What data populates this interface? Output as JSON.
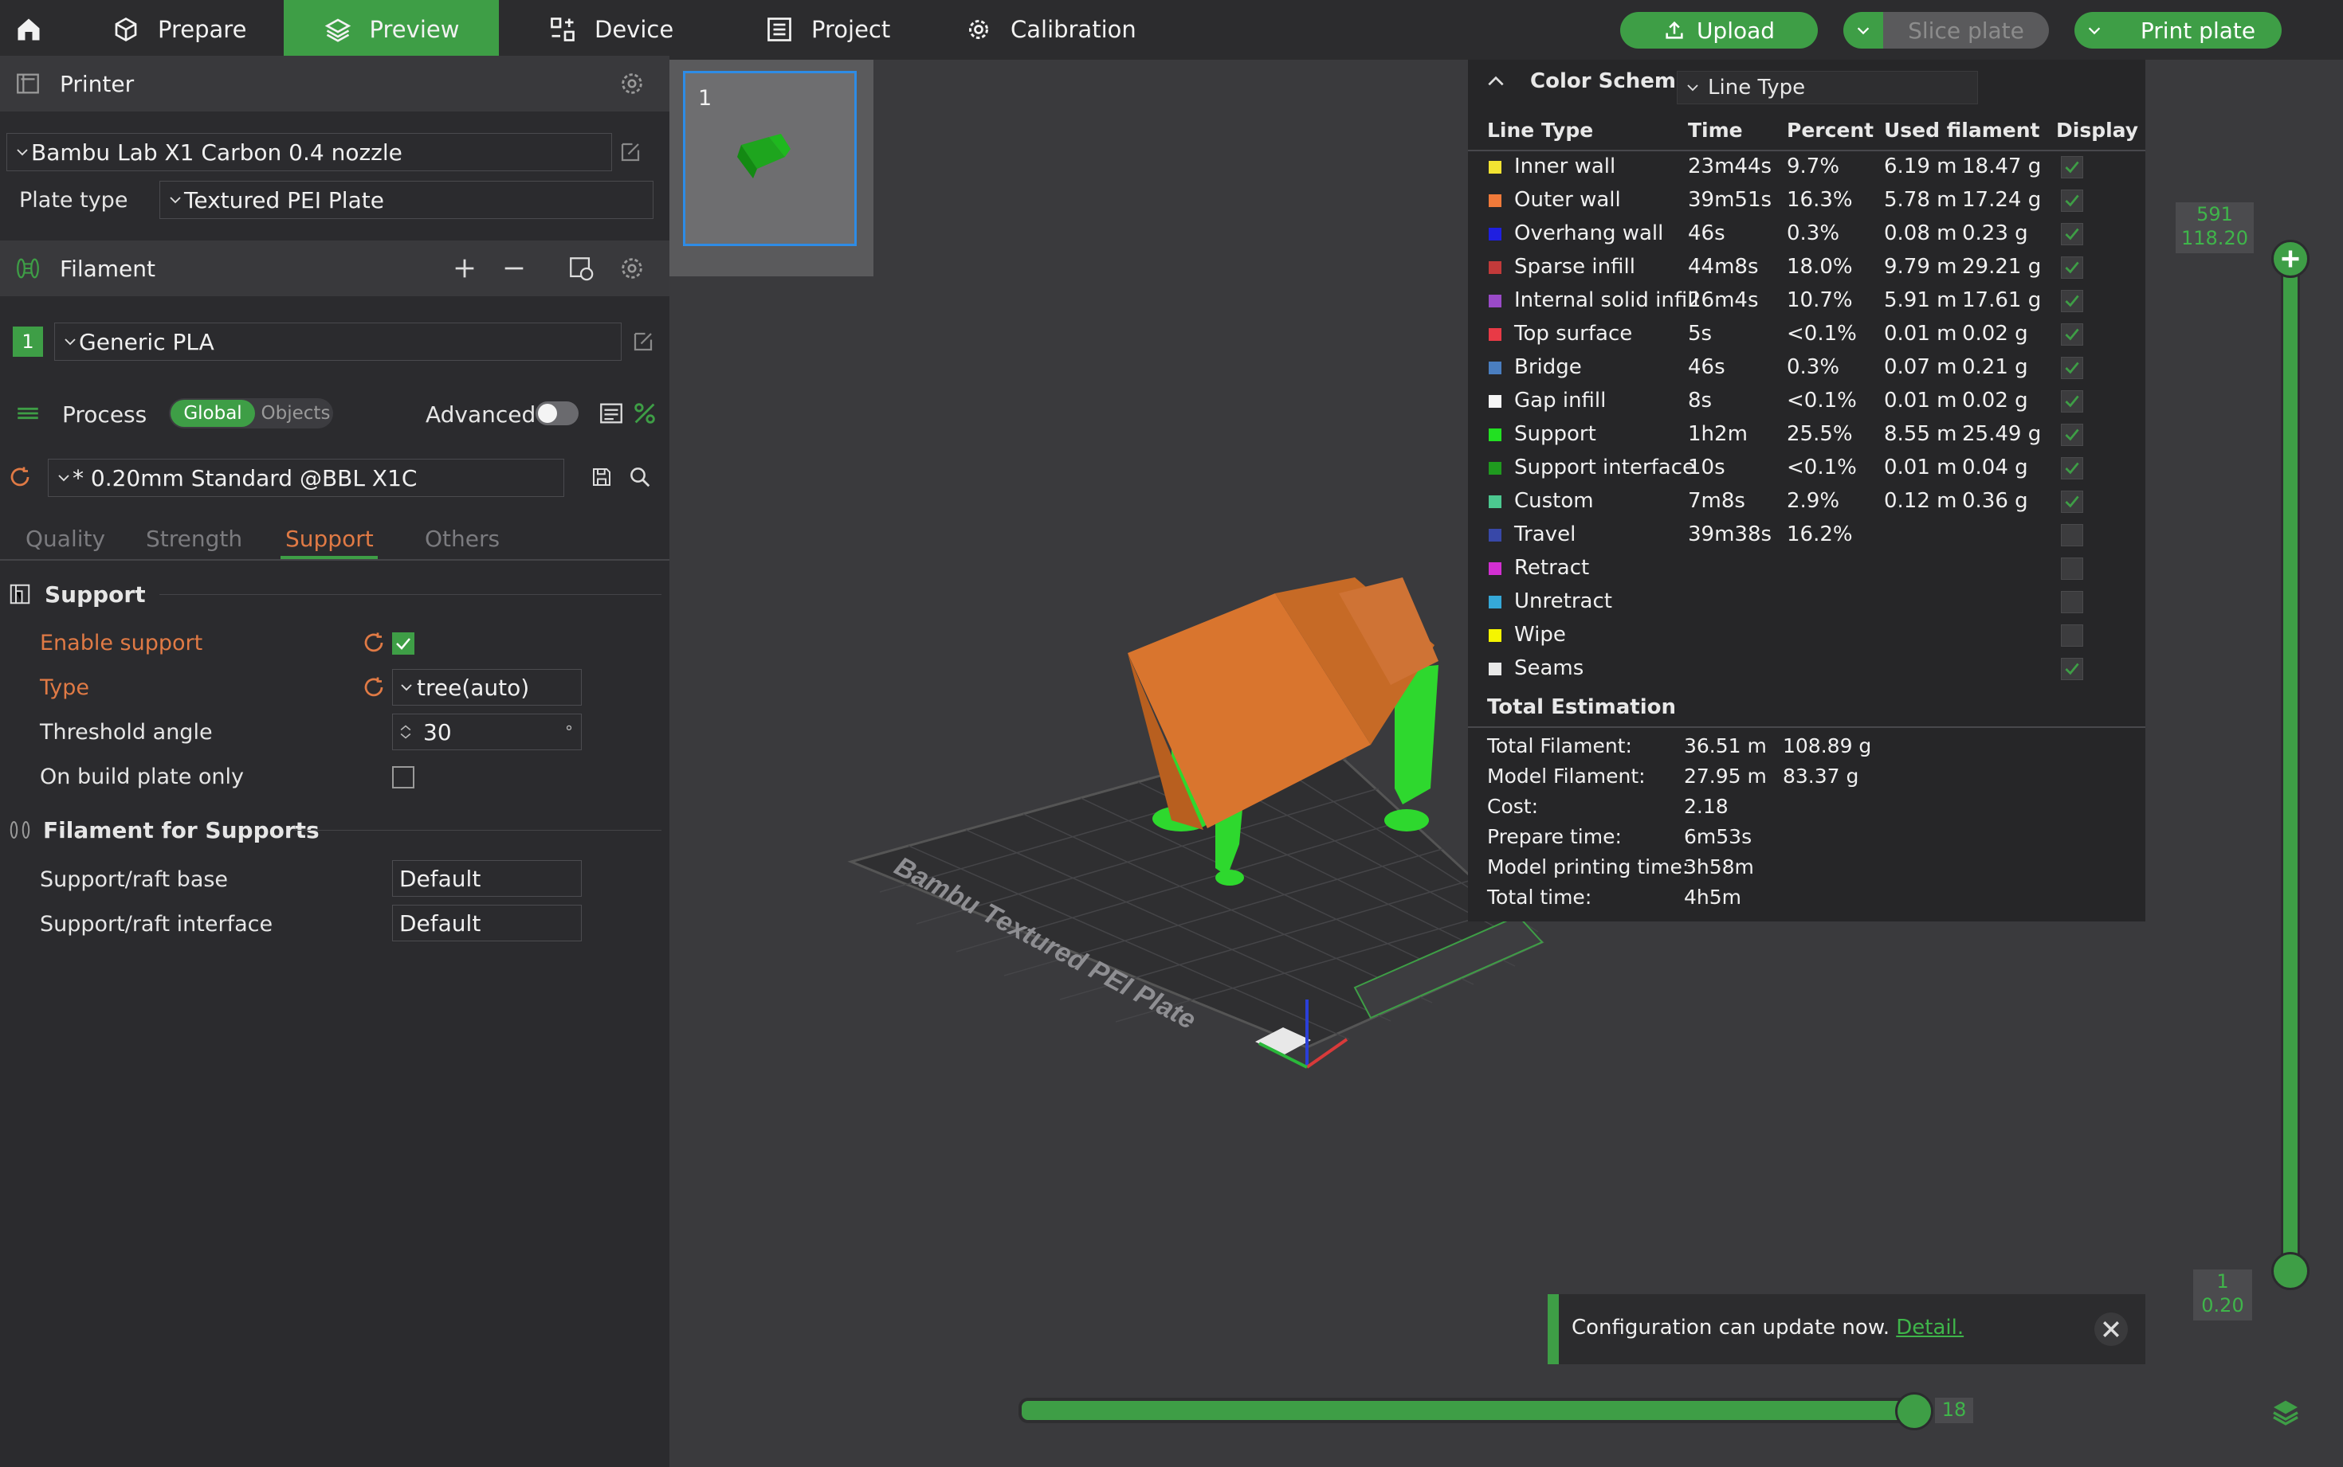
{
  "topbar": {
    "tabs": [
      "Prepare",
      "Preview",
      "Device",
      "Project",
      "Calibration"
    ],
    "upload": "Upload",
    "slice": "Slice plate",
    "print": "Print plate"
  },
  "printer": {
    "title": "Printer",
    "model": "Bambu Lab X1 Carbon 0.4 nozzle",
    "plate_type_label": "Plate type",
    "plate_type": "Textured PEI Plate"
  },
  "filament": {
    "title": "Filament",
    "slot": "1",
    "name": "Generic PLA"
  },
  "process": {
    "title": "Process",
    "global": "Global",
    "objects": "Objects",
    "advanced": "Advanced",
    "profile": "* 0.20mm Standard @BBL X1C",
    "tabs": [
      "Quality",
      "Strength",
      "Support",
      "Others"
    ]
  },
  "support": {
    "title": "Support",
    "enable_label": "Enable support",
    "type_label": "Type",
    "type_value": "tree(auto)",
    "threshold_label": "Threshold angle",
    "threshold_value": "30",
    "threshold_unit": "°",
    "build_plate_label": "On build plate only",
    "filament_title": "Filament for Supports",
    "base_label": "Support/raft base",
    "base_value": "Default",
    "interface_label": "Support/raft interface",
    "interface_value": "Default"
  },
  "thumbnail": {
    "number": "1"
  },
  "legend": {
    "title": "Color Scheme",
    "scheme": "Line Type",
    "headers": [
      "Line Type",
      "Time",
      "Percent",
      "Used filament",
      "Display"
    ],
    "rows": [
      {
        "name": "Inner wall",
        "time": "23m44s",
        "percent": "9.7%",
        "len": "6.19 m",
        "weight": "18.47 g",
        "color": "#f2e332",
        "shown": true
      },
      {
        "name": "Outer wall",
        "time": "39m51s",
        "percent": "16.3%",
        "len": "5.78 m",
        "weight": "17.24 g",
        "color": "#f07a3a",
        "shown": true
      },
      {
        "name": "Overhang wall",
        "time": "46s",
        "percent": "0.3%",
        "len": "0.08 m",
        "weight": "0.23 g",
        "color": "#1f1fe0",
        "shown": true
      },
      {
        "name": "Sparse infill",
        "time": "44m8s",
        "percent": "18.0%",
        "len": "9.79 m",
        "weight": "29.21 g",
        "color": "#c23a3a",
        "shown": true
      },
      {
        "name": "Internal solid infill",
        "time": "26m4s",
        "percent": "10.7%",
        "len": "5.91 m",
        "weight": "17.61 g",
        "color": "#9a4ac8",
        "shown": true
      },
      {
        "name": "Top surface",
        "time": "5s",
        "percent": "<0.1%",
        "len": "0.01 m",
        "weight": "0.02 g",
        "color": "#e83a46",
        "shown": true
      },
      {
        "name": "Bridge",
        "time": "46s",
        "percent": "0.3%",
        "len": "0.07 m",
        "weight": "0.21 g",
        "color": "#4a7ec0",
        "shown": true
      },
      {
        "name": "Gap infill",
        "time": "8s",
        "percent": "<0.1%",
        "len": "0.01 m",
        "weight": "0.02 g",
        "color": "#f5f5f5",
        "shown": true
      },
      {
        "name": "Support",
        "time": "1h2m",
        "percent": "25.5%",
        "len": "8.55 m",
        "weight": "25.49 g",
        "color": "#22e022",
        "shown": true
      },
      {
        "name": "Support interface",
        "time": "10s",
        "percent": "<0.1%",
        "len": "0.01 m",
        "weight": "0.04 g",
        "color": "#1f9a1f",
        "shown": true
      },
      {
        "name": "Custom",
        "time": "7m8s",
        "percent": "2.9%",
        "len": "0.12 m",
        "weight": "0.36 g",
        "color": "#4cc890",
        "shown": true
      },
      {
        "name": "Travel",
        "time": "39m38s",
        "percent": "16.2%",
        "len": "",
        "weight": "",
        "color": "#3848a8",
        "shown": false
      },
      {
        "name": "Retract",
        "time": "",
        "percent": "",
        "len": "",
        "weight": "",
        "color": "#d22fd2",
        "shown": false
      },
      {
        "name": "Unretract",
        "time": "",
        "percent": "",
        "len": "",
        "weight": "",
        "color": "#35a8d8",
        "shown": false
      },
      {
        "name": "Wipe",
        "time": "",
        "percent": "",
        "len": "",
        "weight": "",
        "color": "#f5f500",
        "shown": false
      },
      {
        "name": "Seams",
        "time": "",
        "percent": "",
        "len": "",
        "weight": "",
        "color": "#e8e8e8",
        "shown": true
      }
    ],
    "estimation_title": "Total Estimation",
    "estimation": [
      {
        "label": "Total Filament:",
        "a": "36.51 m",
        "b": "108.89 g"
      },
      {
        "label": "Model Filament:",
        "a": "27.95 m",
        "b": "83.37 g"
      },
      {
        "label": "Cost:",
        "a": "2.18",
        "b": ""
      },
      {
        "label": "Prepare time:",
        "a": "6m53s",
        "b": ""
      },
      {
        "label": "Model printing time:",
        "a": "3h58m",
        "b": ""
      },
      {
        "label": "Total time:",
        "a": "4h5m",
        "b": ""
      }
    ]
  },
  "layers": {
    "top_layer": "591",
    "top_height": "118.20",
    "bottom_layer": "1",
    "bottom_height": "0.20",
    "moves": "18",
    "moves_fraction": 1.0
  },
  "plate_text": "Bambu Textured PEI Plate",
  "notification": {
    "text": "Configuration can update now.",
    "link": "Detail."
  },
  "colors": {
    "accent": "#3e9e46",
    "orange": "#e07a45"
  }
}
